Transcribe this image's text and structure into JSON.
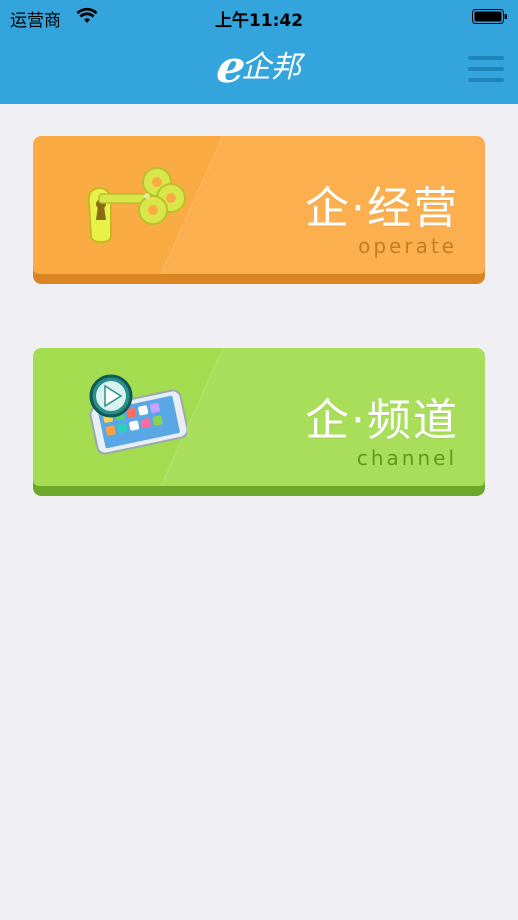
{
  "status_bar": {
    "carrier": "运营商",
    "time": "上午11:42"
  },
  "header": {
    "logo_e": "e",
    "logo_text": "企邦",
    "menu_icon": "hamburger-menu-icon"
  },
  "cards": [
    {
      "title": "企·经营",
      "subtitle": "operate",
      "icon": "key-icon",
      "color": "#fbab43"
    },
    {
      "title": "企·频道",
      "subtitle": "channel",
      "icon": "phone-video-icon",
      "color": "#a3dc4f"
    }
  ],
  "colors": {
    "header": "#33a4dc",
    "background": "#efeff4"
  }
}
